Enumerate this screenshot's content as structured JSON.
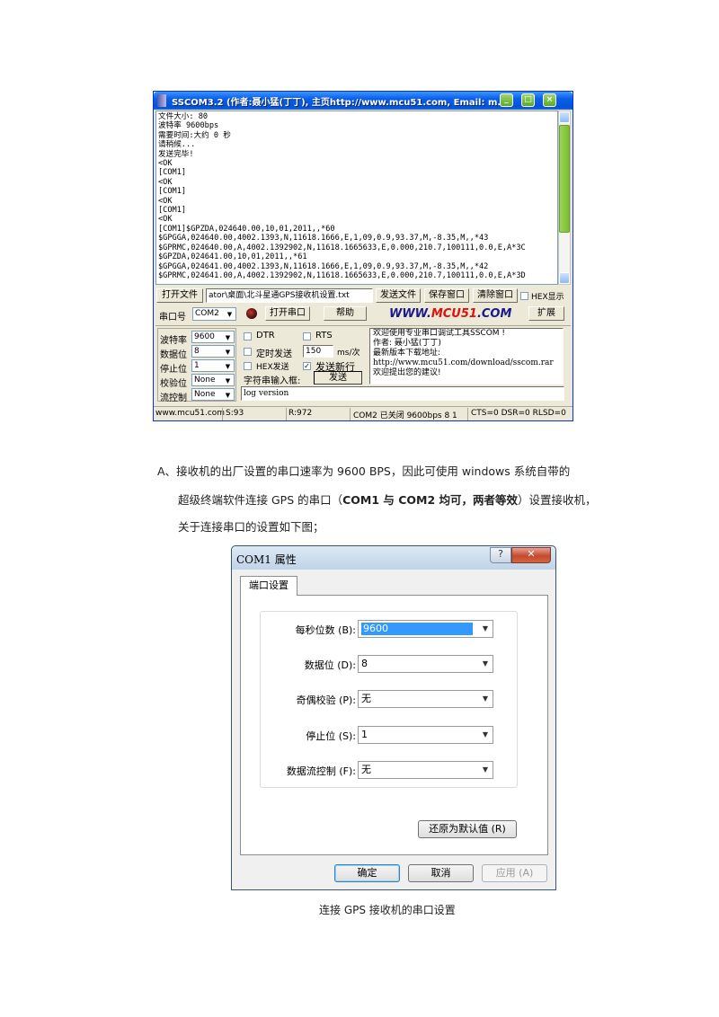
{
  "sscom": {
    "title": "SSCOM3.2 (作者:聂小猛(丁丁), 主页http://www.mcu51.com,  Email: m...",
    "receive_lines": [
      "文件大小: 80",
      "波特率 9600bps",
      "需要时间:大约 0 秒",
      "请稍候...",
      "发送完毕!",
      "<OK",
      "[COM1]",
      "<OK",
      "[COM1]",
      "<OK",
      "[COM1]",
      "<OK",
      "[COM1]$GPZDA,024640.00,10,01,2011,,*60",
      "$GPGGA,024640.00,4002.1393,N,11618.1666,E,1,09,0.9,93.37,M,-8.35,M,,*43",
      "$GPRMC,024640.00,A,4002.1392902,N,11618.1665633,E,0.000,210.7,100111,0.0,E,A*3C",
      "$GPZDA,024641.00,10,01,2011,,*61",
      "$GPGGA,024641.00,4002.1393,N,11618.1666,E,1,09,0.9,93.37,M,-8.35,M,,*42",
      "$GPRMC,024641.00,A,4002.1392902,N,11618.1665633,E,0.000,210.7,100111,0.0,E,A*3D"
    ],
    "open_file_label": "打开文件",
    "file_path": "ator\\桌面\\北斗星通GPS接收机设置.txt",
    "send_file_label": "发送文件",
    "save_window_label": "保存窗口",
    "clear_window_label": "清除窗口",
    "hex_display_label": "HEX显示",
    "port_label": "串口号",
    "port_value": "COM2",
    "open_port_label": "打开串口",
    "help_label": "帮助",
    "brand_www": "WWW.",
    "brand_mcu": "MCU51",
    "brand_com": ".COM",
    "expand_label": "扩展",
    "baud_label": "波特率",
    "baud_value": "9600",
    "databits_label": "数据位",
    "databits_value": "8",
    "stopbits_label": "停止位",
    "stopbits_value": "1",
    "parity_label": "校验位",
    "parity_value": "None",
    "flow_label": "流控制",
    "flow_value": "None",
    "dtr_label": "DTR",
    "rts_label": "RTS",
    "timed_send_label": "定时发送",
    "interval_value": "150",
    "interval_unit": "ms/次",
    "hex_send_label": "HEX发送",
    "send_newline_label": "发送新行",
    "string_input_label": "字符串输入框:",
    "send_label": "发送",
    "input_value": "log version",
    "info_lines": [
      "欢迎使用专业串口调试工具SSCOM !",
      "作者: 聂小猛(丁丁)",
      "最新版本下载地址:",
      "http://www.mcu51.com/download/sscom.rar",
      "欢迎提出您的建议!"
    ],
    "status": {
      "site": "www.mcu51.com",
      "sent": "S:93",
      "received": "R:972",
      "port_state": "COM2 已关闭  9600bps  8 1",
      "lines": "CTS=0 DSR=0 RLSD=0"
    }
  },
  "doc": {
    "para_prefix": "A、",
    "line1": "接收机的出厂设置的串口速率为 9600 BPS，因此可使用 windows 系统自带的",
    "line2_a": "超级终端软件连接 GPS 的串口（",
    "line2_b": "COM1 与 COM2 均可，两者等效",
    "line2_c": "）设置接收机，",
    "line3": "关于连接串口的设置如下图；",
    "caption": "连接 GPS 接收机的串口设置"
  },
  "com1": {
    "title": "COM1 属性",
    "help_icon": "?",
    "close_icon": "✕",
    "tab_label": "端口设置",
    "fields": [
      {
        "label": "每秒位数 (B):",
        "value": "9600"
      },
      {
        "label": "数据位 (D):",
        "value": "8"
      },
      {
        "label": "奇偶校验 (P):",
        "value": "无"
      },
      {
        "label": "停止位 (S):",
        "value": "1"
      },
      {
        "label": "数据流控制 (F):",
        "value": "无"
      }
    ],
    "restore_label": "还原为默认值 (R)",
    "ok_label": "确定",
    "cancel_label": "取消",
    "apply_label": "应用 (A)"
  }
}
